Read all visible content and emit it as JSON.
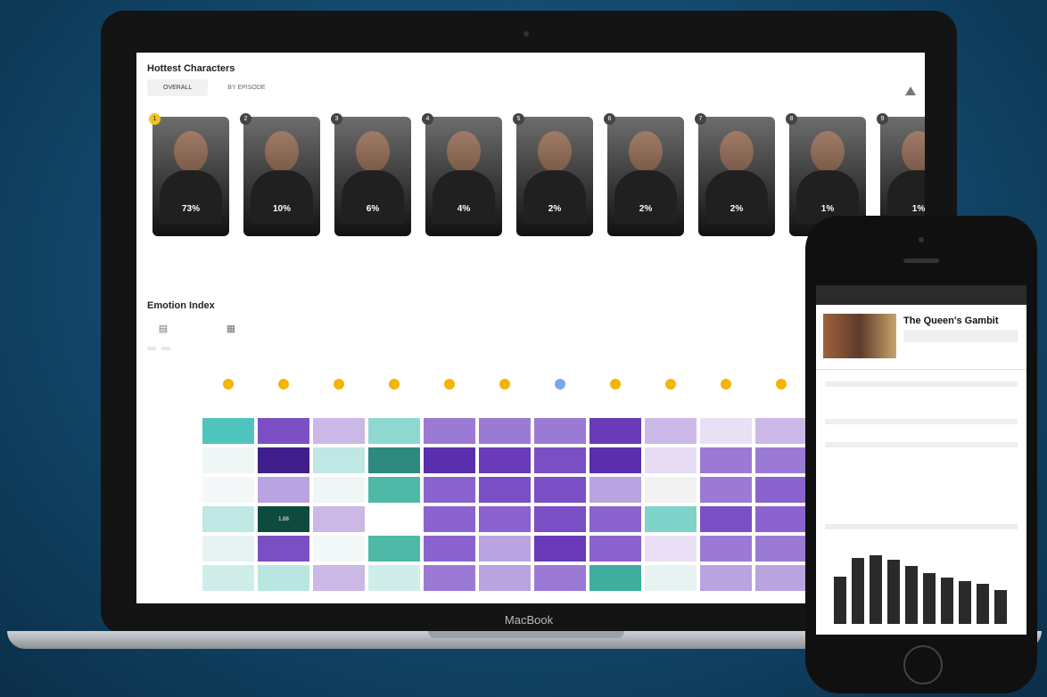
{
  "laptop": {
    "brand": "MacBook"
  },
  "dashboard": {
    "title": "Hottest Characters",
    "tabs": [
      {
        "label": "OVERALL",
        "active": true
      },
      {
        "label": "BY EPISODE",
        "active": false
      }
    ],
    "characters": [
      {
        "rank": "1",
        "pct": "73%"
      },
      {
        "rank": "2",
        "pct": "10%"
      },
      {
        "rank": "3",
        "pct": "6%"
      },
      {
        "rank": "4",
        "pct": "4%"
      },
      {
        "rank": "5",
        "pct": "2%"
      },
      {
        "rank": "6",
        "pct": "2%"
      },
      {
        "rank": "7",
        "pct": "2%"
      },
      {
        "rank": "8",
        "pct": "1%"
      },
      {
        "rank": "9",
        "pct": "1%"
      }
    ],
    "emotion_title": "Emotion Index",
    "filter_chips": [
      "",
      ""
    ],
    "heatmap": {
      "rows": [
        "",
        "",
        "",
        "",
        "",
        ""
      ],
      "cells": [
        [
          "",
          "",
          "",
          "",
          "",
          "",
          "",
          "",
          "",
          "",
          ""
        ],
        [
          "",
          "",
          "",
          "",
          "",
          "",
          "",
          "",
          "",
          "",
          ""
        ],
        [
          "",
          "",
          "",
          "",
          "",
          "",
          "",
          "",
          "",
          "",
          ""
        ],
        [
          "",
          "1.88",
          "",
          "",
          "",
          "",
          "",
          "",
          "",
          "",
          ""
        ],
        [
          "",
          "",
          "",
          "",
          "",
          "",
          "",
          "",
          "",
          "",
          ""
        ],
        [
          "",
          "",
          "",
          "",
          "",
          "",
          "",
          "",
          "",
          "",
          ""
        ]
      ],
      "colors": [
        [
          "#4fc3bd",
          "#7b4fc4",
          "#cbb8e6",
          "#8fd8d2",
          "#9b7ad6",
          "#9b7ad6",
          "#9b7ad6",
          "#6a3bb8",
          "#cbb8e6",
          "#e9e0f5",
          "#cbb8e6"
        ],
        [
          "#eef6f6",
          "#3e1f8c",
          "#bfe7e3",
          "#2d8a7e",
          "#5a2fae",
          "#6a3bb8",
          "#7b4fc4",
          "#5a2fae",
          "#e6dcf3",
          "#9b7ad6",
          "#9b7ad6"
        ],
        [
          "#f4f8f8",
          "#b9a3e0",
          "#eef6f6",
          "#4fb9a8",
          "#8a63cf",
          "#7b4fc4",
          "#7b4fc4",
          "#b9a3e0",
          "#f2f2f2",
          "#9b7ad6",
          "#8a63cf"
        ],
        [
          "#bfe7e3",
          "#0f4a3e",
          "#cbb8e6",
          "#ffffff",
          "#8a63cf",
          "#8a63cf",
          "#7b4fc4",
          "#8a63cf",
          "#7fd3c8",
          "#7b4fc4",
          "#8a63cf"
        ],
        [
          "#e6f3f2",
          "#7b4fc4",
          "#f2f7f7",
          "#4fb9a8",
          "#8a63cf",
          "#b9a3e0",
          "#6a3bb8",
          "#8a63cf",
          "#e9e0f5",
          "#9b7ad6",
          "#9b7ad6"
        ],
        [
          "#cfeeea",
          "#b9e6e0",
          "#cbb8e6",
          "#cfeeea",
          "#9b7ad6",
          "#b9a3e0",
          "#9b7ad6",
          "#3fae9e",
          "#e6f3f2",
          "#b9a3e0",
          "#b9a3e0"
        ]
      ]
    }
  },
  "phone": {
    "show_title": "The Queen's Gambit",
    "bars": [
      0.62,
      0.86,
      0.9,
      0.84,
      0.76,
      0.66,
      0.6,
      0.56,
      0.52,
      0.44
    ]
  }
}
